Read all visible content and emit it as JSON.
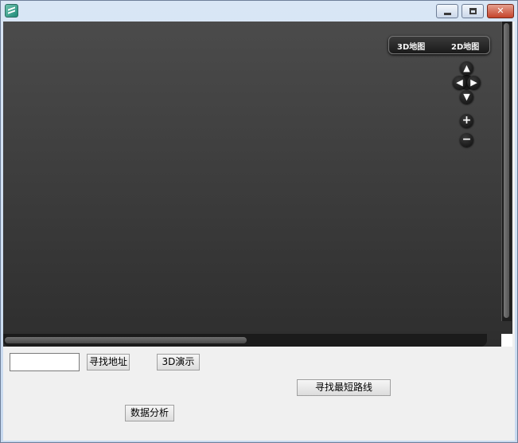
{
  "window": {
    "minimize_glyph": "",
    "maximize_glyph": "",
    "close_glyph": "✕"
  },
  "map": {
    "mode_3d": "3D地图",
    "mode_2d": "2D地图",
    "nav_up": "▲",
    "nav_down": "▼",
    "nav_left": "◀",
    "nav_right": "▶",
    "zoom_in": "+",
    "zoom_out": "−"
  },
  "controls": {
    "search_input_value": "",
    "find_address_label": "寻找地址",
    "demo_3d_label": "3D演示",
    "shortest_route_label": "寻找最短路线",
    "data_analysis_label": "数据分析"
  }
}
